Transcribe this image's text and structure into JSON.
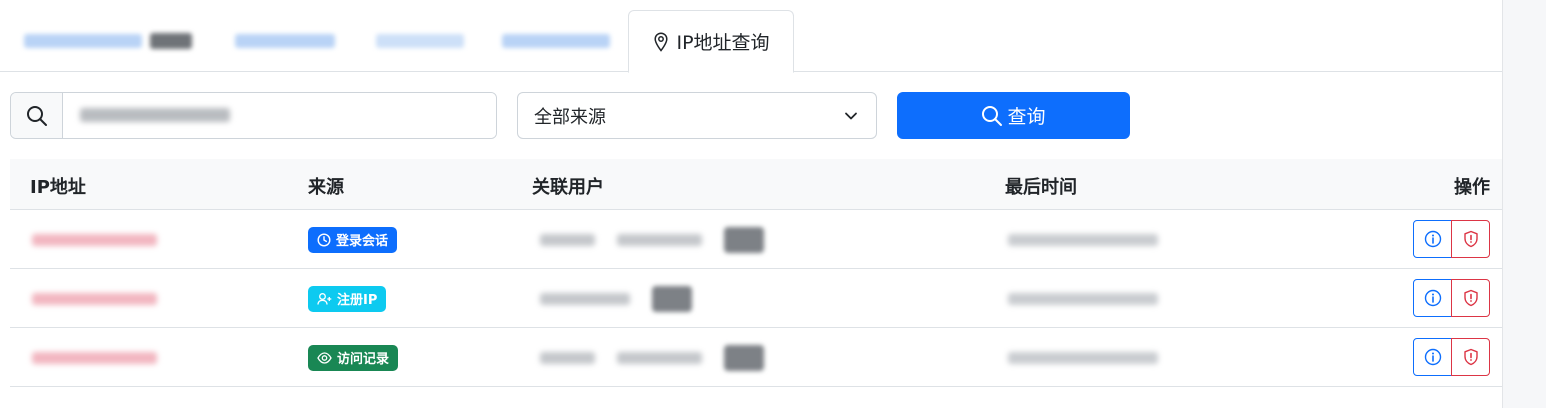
{
  "tabs": {
    "active_label": "IP地址查询",
    "blurred": [
      {
        "width": 165,
        "color": "#b9d3f6"
      },
      {
        "width": 105,
        "color": "#b9d3f6"
      },
      {
        "width": 90,
        "color": "#cde0f8"
      },
      {
        "width": 110,
        "color": "#b9d3f6"
      }
    ]
  },
  "search": {
    "icon": "search-icon",
    "placeholder": ""
  },
  "source_select": {
    "selected": "全部来源",
    "icon": "chevron-down-icon"
  },
  "query_button": {
    "label": "查询",
    "icon": "search-icon",
    "color": "#0d6efd"
  },
  "table": {
    "headers": {
      "ip": "IP地址",
      "source": "来源",
      "user": "关联用户",
      "last_time": "最后时间",
      "actions": "操作"
    },
    "rows": [
      {
        "source_label": "登录会话",
        "source_icon": "clock-icon",
        "source_variant": "primary",
        "user_parts": 2
      },
      {
        "source_label": "注册IP",
        "source_icon": "user-plus-icon",
        "source_variant": "info",
        "user_parts": 1
      },
      {
        "source_label": "访问记录",
        "source_icon": "eye-icon",
        "source_variant": "success",
        "user_parts": 2
      }
    ],
    "row_actions": [
      "info-icon",
      "shield-alert-icon"
    ]
  },
  "colors": {
    "primary": "#0d6efd",
    "info": "#0dcaf0",
    "success": "#198754",
    "danger": "#dc3545"
  }
}
